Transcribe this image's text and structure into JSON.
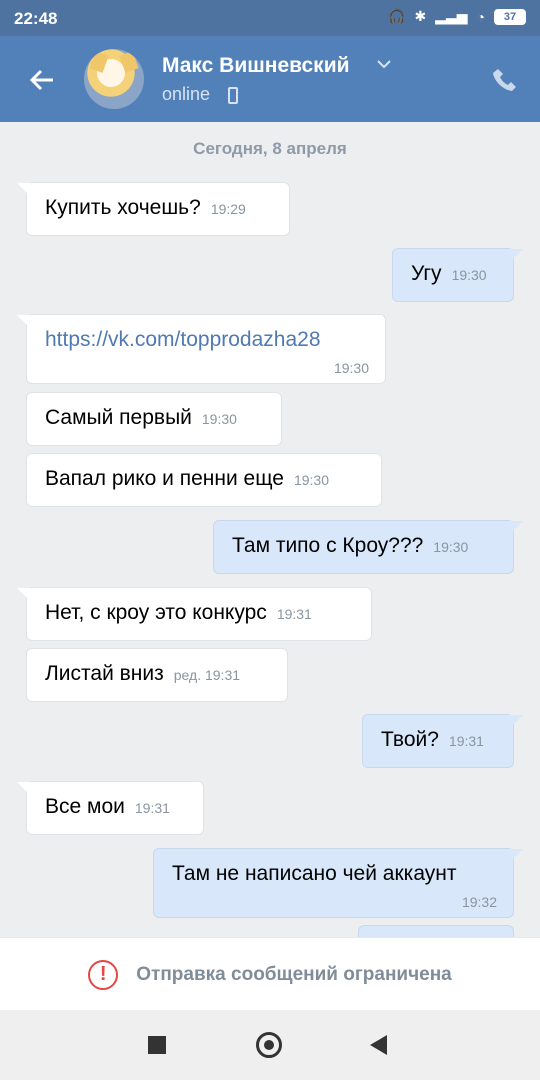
{
  "status_bar": {
    "time": "22:48",
    "battery": "37"
  },
  "header": {
    "name": "Макс Вишневский",
    "status": "online"
  },
  "date_separator": "Сегодня, 8 апреля",
  "messages": [
    {
      "text": "Купить хочешь?",
      "time": "19:29"
    },
    {
      "text": "Угу",
      "time": "19:30"
    },
    {
      "text": "https://vk.com/topprodazha28",
      "time": "19:30"
    },
    {
      "text": "Самый первый",
      "time": "19:30"
    },
    {
      "text": "Вапал рико и пенни еще",
      "time": "19:30"
    },
    {
      "text": "Там типо с Кроу???",
      "time": "19:30"
    },
    {
      "text": "Нет, с кроу это конкурс",
      "time": "19:31"
    },
    {
      "text": "Листай вниз",
      "time": "ред. 19:31"
    },
    {
      "text": "Твой?",
      "time": "19:31"
    },
    {
      "text": "Все мои",
      "time": "19:31"
    },
    {
      "text": "Там не написано чей аккаунт",
      "time": "19:32"
    }
  ],
  "restricted_message": "Отправка сообщений ограничена",
  "icons": [
    "wifi-icon",
    "bluetooth-icon",
    "signal-icon",
    "battery-icon",
    "back-arrow-icon",
    "chevron-down-icon",
    "phone-icon",
    "warning-icon",
    "nav-square-icon",
    "nav-home-icon",
    "nav-back-icon"
  ]
}
